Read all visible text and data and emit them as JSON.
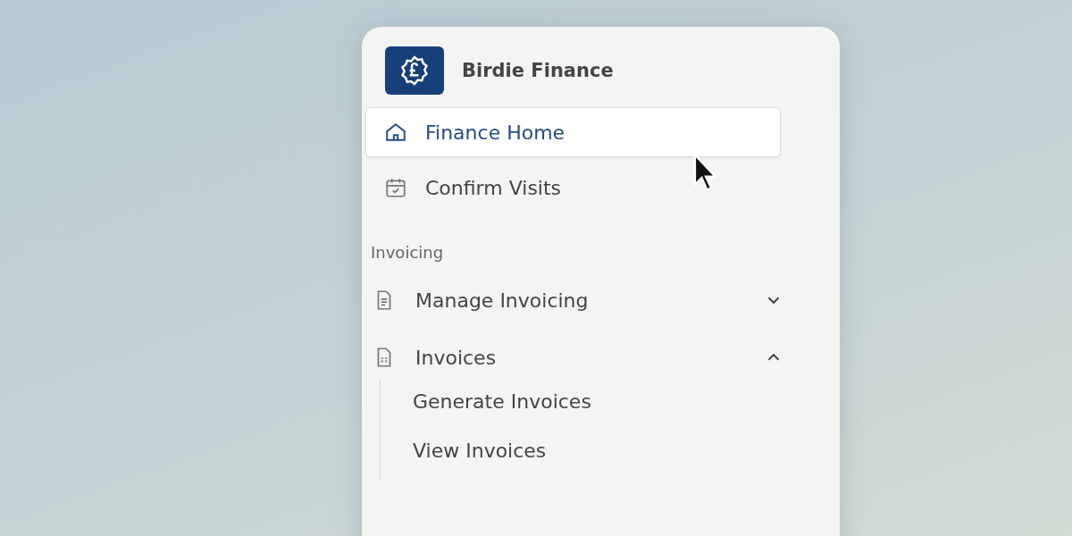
{
  "brand": {
    "name": "Birdie Finance"
  },
  "nav": [
    {
      "label": "Finance Home",
      "selected": true,
      "kind": "home"
    },
    {
      "label": "Confirm Visits",
      "selected": false,
      "kind": "calendar"
    }
  ],
  "section": {
    "title": "Invoicing",
    "items": [
      {
        "label": "Manage Invoicing",
        "kind": "document",
        "expanded": false
      },
      {
        "label": "Invoices",
        "kind": "sheet",
        "expanded": true,
        "children": [
          {
            "label": "Generate Invoices"
          },
          {
            "label": "View Invoices"
          }
        ]
      }
    ]
  }
}
